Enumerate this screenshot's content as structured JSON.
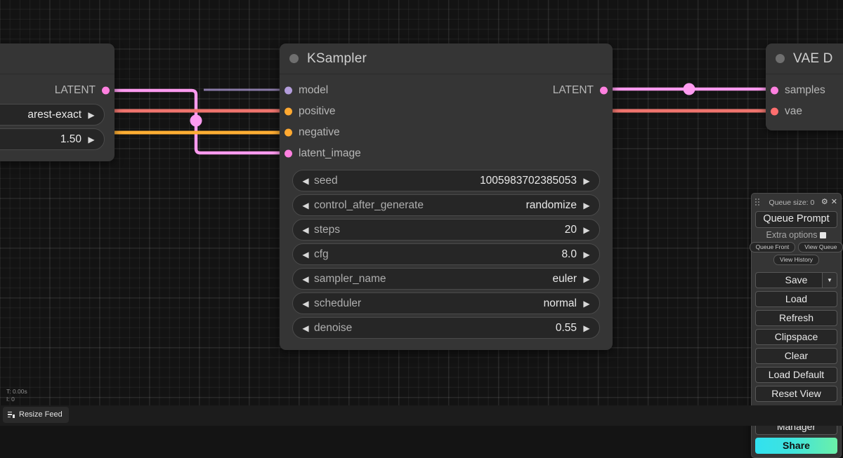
{
  "app": {
    "name": "ComfyUI"
  },
  "nodes": {
    "left_partial": {
      "title": "",
      "outputs": [
        {
          "label": "LATENT",
          "color": "#FF80E0"
        }
      ],
      "widgets": [
        {
          "name": "",
          "value": "arest-exact"
        },
        {
          "name": "",
          "value": "1.50"
        }
      ]
    },
    "ksampler": {
      "title": "KSampler",
      "inputs": [
        {
          "label": "model",
          "color": "#B39DDB"
        },
        {
          "label": "positive",
          "color": "#FFA931"
        },
        {
          "label": "negative",
          "color": "#FFA931"
        },
        {
          "label": "latent_image",
          "color": "#FF80E0"
        }
      ],
      "outputs": [
        {
          "label": "LATENT",
          "color": "#FF80E0"
        }
      ],
      "widgets": [
        {
          "name": "seed",
          "value": "1005983702385053"
        },
        {
          "name": "control_after_generate",
          "value": "randomize"
        },
        {
          "name": "steps",
          "value": "20"
        },
        {
          "name": "cfg",
          "value": "8.0"
        },
        {
          "name": "sampler_name",
          "value": "euler"
        },
        {
          "name": "scheduler",
          "value": "normal"
        },
        {
          "name": "denoise",
          "value": "0.55"
        }
      ]
    },
    "right_partial": {
      "title": "VAE D",
      "inputs": [
        {
          "label": "samples",
          "color": "#FF80E0"
        },
        {
          "label": "vae",
          "color": "#FF6E6E"
        }
      ]
    }
  },
  "menu": {
    "queue_size_label": "Queue size: 0",
    "gear_icon": "gear-icon",
    "close_icon": "close-icon",
    "queue_prompt": "Queue Prompt",
    "extra_options": "Extra options",
    "queue_front": "Queue Front",
    "view_queue": "View Queue",
    "view_history": "View History",
    "save": "Save",
    "save_caret": "▼",
    "load": "Load",
    "refresh": "Refresh",
    "clipspace": "Clipspace",
    "clear": "Clear",
    "load_default": "Load Default",
    "reset_view": "Reset View",
    "manager": "Manager",
    "share": "Share",
    "share_color": "#31E1F0"
  },
  "stats": {
    "time": "T: 0.00s",
    "iterations": "I: 0"
  },
  "bottom": {
    "resize_feed": "Resize Feed"
  },
  "glyphs": {
    "left_arrow": "◀",
    "right_arrow": "▶"
  }
}
